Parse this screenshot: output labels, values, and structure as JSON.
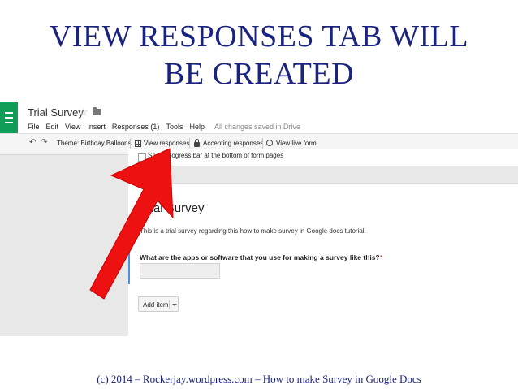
{
  "slide": {
    "title_line1": "VIEW RESPONSES TAB WILL",
    "title_line2": "BE CREATED",
    "footer": "(c) 2014 – Rockerjay.wordpress.com – How to make Survey in Google Docs"
  },
  "app": {
    "doc_title": "Trial Survey",
    "menu": [
      "File",
      "Edit",
      "View",
      "Insert",
      "Responses (1)",
      "Tools",
      "Help"
    ],
    "save_status": "All changes saved in Drive"
  },
  "toolbar": {
    "theme": "Theme: Birthday Balloons",
    "view_responses": "View responses",
    "accepting_responses": "Accepting responses",
    "view_live_form": "View live form"
  },
  "settings": {
    "progress_bar_label": "Show progress bar at the bottom of form pages"
  },
  "form": {
    "title": "Trial Survey",
    "description": "This is a trial survey regarding this how to make survey in Google docs tutorial.",
    "question": "What are the apps or software that you use for making a survey like this?",
    "required_mark": "*",
    "add_item_label": "Add item"
  },
  "colors": {
    "title_text": "#1a237e",
    "forms_brand": "#0f9d58",
    "annotation_arrow": "#ee1111",
    "question_accent": "#4a90e2"
  }
}
